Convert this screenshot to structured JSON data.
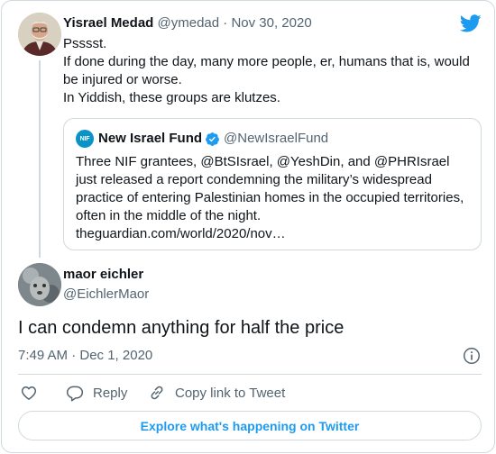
{
  "colors": {
    "accent": "#1d9bf0",
    "text": "#0f1419",
    "muted": "#536471",
    "border": "#cfd9de",
    "nif_logo": "#0a93c6"
  },
  "parent_tweet": {
    "name": "Yisrael Medad",
    "handle": "@ymedad",
    "separator": "·",
    "date": "Nov 30, 2020",
    "lines": [
      "Psssst.",
      "If done during the day, many more people, er, humans that is, would",
      "be injured or worse.",
      "In Yiddish, these groups are klutzes."
    ]
  },
  "quoted_tweet": {
    "logo_text": "NIF",
    "name": "New Israel Fund",
    "verified_icon": "verified-badge-icon",
    "handle": "@NewIsraelFund",
    "lines": [
      "Three NIF grantees, @BtSIsrael, @YeshDin, and @PHRIsrael",
      "just released a report condemning the military’s widespread",
      "practice of entering Palestinian homes in the occupied territories,",
      "often in the middle of the night.",
      "theguardian.com/world/2020/nov…"
    ]
  },
  "reply_tweet": {
    "name": "maor eichler",
    "handle": "@EichlerMaor",
    "text": "I can condemn anything for half the price",
    "timestamp": "7:49 AM · Dec 1, 2020"
  },
  "actions": {
    "like_icon": "heart-icon",
    "reply_label": "Reply",
    "copy_label": "Copy link to Tweet"
  },
  "explore_label": "Explore what's happening on Twitter"
}
